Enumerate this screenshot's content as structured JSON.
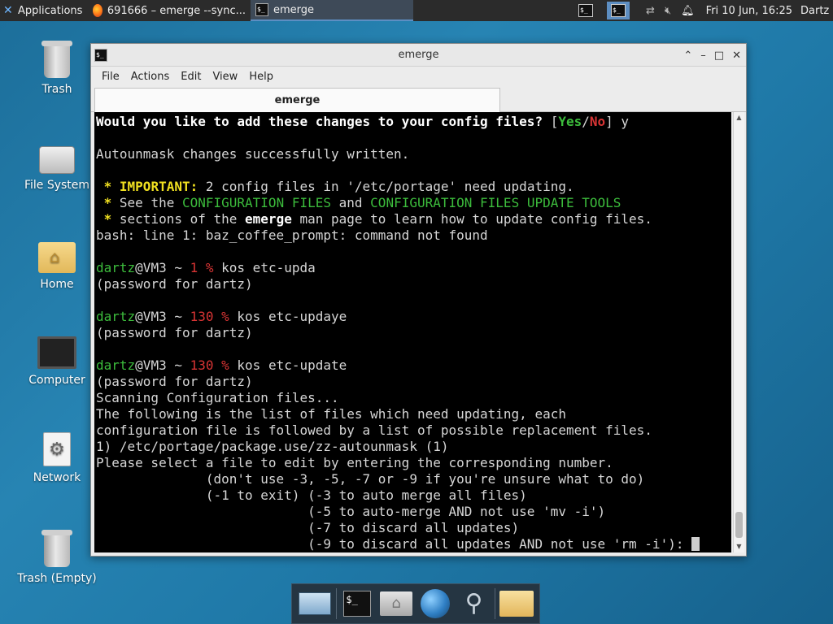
{
  "top_panel": {
    "applications_label": "Applications",
    "tasks": [
      {
        "label": "691666 – emerge --sync...",
        "icon": "firefox-icon"
      },
      {
        "label": "emerge",
        "icon": "terminal-icon"
      }
    ],
    "clock": "Fri 10 Jun, 16:25",
    "user": "Dartz"
  },
  "desktop_icons": [
    {
      "label": "Trash"
    },
    {
      "label": "File System"
    },
    {
      "label": "Home"
    },
    {
      "label": "Computer"
    },
    {
      "label": "Network"
    },
    {
      "label": "Trash (Empty)"
    }
  ],
  "window": {
    "title": "emerge",
    "menu": [
      "File",
      "Actions",
      "Edit",
      "View",
      "Help"
    ],
    "tab_label": "emerge"
  },
  "terminal": {
    "lines": [
      [
        {
          "t": "Would you like to add these changes to your config files? ",
          "c": "b"
        },
        {
          "t": "[",
          "c": ""
        },
        {
          "t": "Yes",
          "c": "gb"
        },
        {
          "t": "/",
          "c": ""
        },
        {
          "t": "No",
          "c": "rb"
        },
        {
          "t": "] y",
          "c": ""
        }
      ],
      [],
      [
        {
          "t": "Autounmask changes successfully written.",
          "c": ""
        }
      ],
      [],
      [
        {
          "t": " * ",
          "c": "y"
        },
        {
          "t": "IMPORTANT:",
          "c": "y"
        },
        {
          "t": " 2 config files in '/etc/portage' need updating.",
          "c": ""
        }
      ],
      [
        {
          "t": " * ",
          "c": "y"
        },
        {
          "t": "See the ",
          "c": ""
        },
        {
          "t": "CONFIGURATION FILES",
          "c": "g"
        },
        {
          "t": " and ",
          "c": ""
        },
        {
          "t": "CONFIGURATION FILES UPDATE TOOLS",
          "c": "g"
        }
      ],
      [
        {
          "t": " * ",
          "c": "y"
        },
        {
          "t": "sections of the ",
          "c": ""
        },
        {
          "t": "emerge",
          "c": "b"
        },
        {
          "t": " man page to learn how to update config files.",
          "c": ""
        }
      ],
      [
        {
          "t": "bash: line 1: baz_coffee_prompt: command not found",
          "c": ""
        }
      ],
      [],
      [
        {
          "t": "dartz",
          "c": "g"
        },
        {
          "t": "@VM3 ~ ",
          "c": ""
        },
        {
          "t": "1 %",
          "c": "r"
        },
        {
          "t": " kos etc-upda",
          "c": ""
        }
      ],
      [
        {
          "t": "(password for dartz)",
          "c": ""
        }
      ],
      [],
      [
        {
          "t": "dartz",
          "c": "g"
        },
        {
          "t": "@VM3 ~ ",
          "c": ""
        },
        {
          "t": "130 %",
          "c": "r"
        },
        {
          "t": " kos etc-updaye",
          "c": ""
        }
      ],
      [
        {
          "t": "(password for dartz)",
          "c": ""
        }
      ],
      [],
      [
        {
          "t": "dartz",
          "c": "g"
        },
        {
          "t": "@VM3 ~ ",
          "c": ""
        },
        {
          "t": "130 %",
          "c": "r"
        },
        {
          "t": " kos etc-update",
          "c": ""
        }
      ],
      [
        {
          "t": "(password for dartz)",
          "c": ""
        }
      ],
      [
        {
          "t": "Scanning Configuration files...",
          "c": ""
        }
      ],
      [
        {
          "t": "The following is the list of files which need updating, each",
          "c": ""
        }
      ],
      [
        {
          "t": "configuration file is followed by a list of possible replacement files.",
          "c": ""
        }
      ],
      [
        {
          "t": "1) /etc/portage/package.use/zz-autounmask (1)",
          "c": ""
        }
      ],
      [
        {
          "t": "Please select a file to edit by entering the corresponding number.",
          "c": ""
        }
      ],
      [
        {
          "t": "              (don't use -3, -5, -7 or -9 if you're unsure what to do)",
          "c": ""
        }
      ],
      [
        {
          "t": "              (-1 to exit) (-3 to auto merge all files)",
          "c": ""
        }
      ],
      [
        {
          "t": "                           (-5 to auto-merge AND not use 'mv -i')",
          "c": ""
        }
      ],
      [
        {
          "t": "                           (-7 to discard all updates)",
          "c": ""
        }
      ],
      [
        {
          "t": "                           (-9 to discard all updates AND not use 'rm -i'): ",
          "c": ""
        }
      ]
    ]
  },
  "dock": {
    "items": [
      "desktop-icon",
      "terminal-icon",
      "home-folder-icon",
      "web-browser-icon",
      "search-icon",
      "folder-icon"
    ]
  }
}
